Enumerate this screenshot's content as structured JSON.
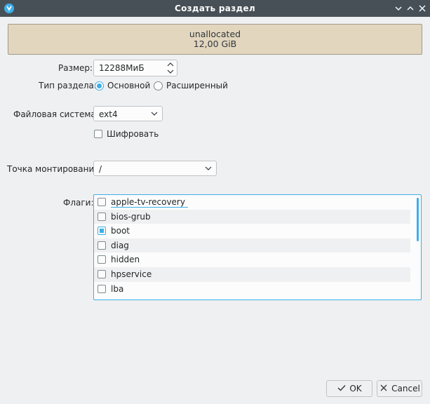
{
  "window": {
    "title": "Создать раздел",
    "icon": "kde-partition-manager-icon",
    "controls": [
      "chevron-down-icon",
      "chevron-up-icon",
      "close-icon"
    ]
  },
  "preview": {
    "line1": "unallocated",
    "line2": "12,00 GiB"
  },
  "size": {
    "label": "Размер:",
    "value": "12288МиБ"
  },
  "partition_type": {
    "label": "Тип раздела:",
    "options": [
      {
        "label": "Основной",
        "selected": true
      },
      {
        "label": "Расширенный",
        "selected": false
      }
    ]
  },
  "filesystem": {
    "label": "Файловая система:",
    "value": "ext4"
  },
  "encrypt": {
    "label": "Шифровать",
    "checked": false
  },
  "mount": {
    "label": "Точка монтирования",
    "value": "/"
  },
  "flags": {
    "label": "Флаги:",
    "items": [
      {
        "name": "apple-tv-recovery",
        "checked": false
      },
      {
        "name": "bios-grub",
        "checked": false
      },
      {
        "name": "boot",
        "checked": true
      },
      {
        "name": "diag",
        "checked": false
      },
      {
        "name": "hidden",
        "checked": false
      },
      {
        "name": "hpservice",
        "checked": false
      },
      {
        "name": "lba",
        "checked": false
      }
    ]
  },
  "buttons": {
    "ok": "OK",
    "cancel": "Cancel"
  },
  "colors": {
    "accent": "#3daee9",
    "titlebar": "#475057",
    "preview_fill": "#e2d6bf"
  }
}
